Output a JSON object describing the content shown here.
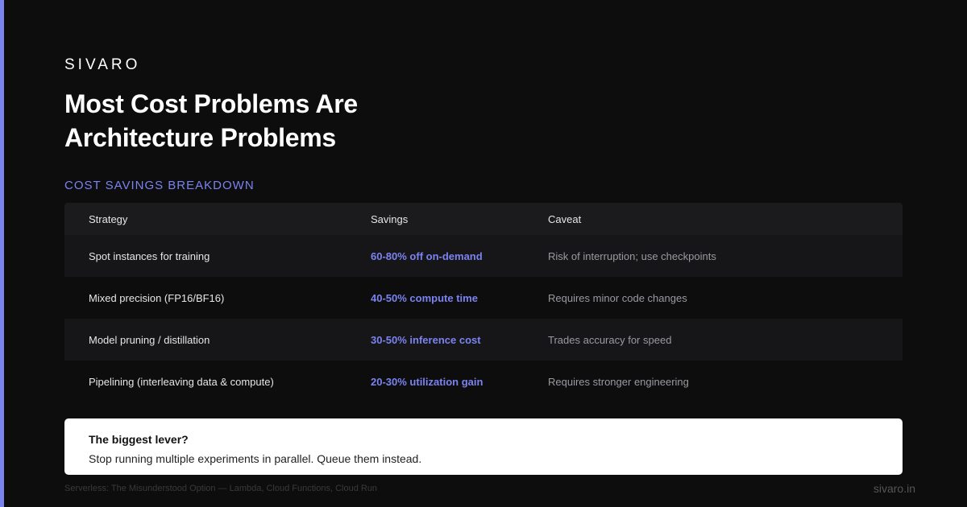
{
  "brand": "SIVARO",
  "title_lines": [
    "Most Cost Problems Are",
    "Architecture Problems"
  ],
  "section_label": "COST SAVINGS BREAKDOWN",
  "table": {
    "headers": [
      "Strategy",
      "Savings",
      "Caveat"
    ],
    "rows": [
      {
        "strategy": "Spot instances for training",
        "savings": "60-80% off on-demand",
        "caveat": "Risk of interruption; use checkpoints"
      },
      {
        "strategy": "Mixed precision (FP16/BF16)",
        "savings": "40-50% compute time",
        "caveat": "Requires minor code changes"
      },
      {
        "strategy": "Model pruning / distillation",
        "savings": "30-50% inference cost",
        "caveat": "Trades accuracy for speed"
      },
      {
        "strategy": "Pipelining (interleaving data & compute)",
        "savings": "20-30% utilization gain",
        "caveat": "Requires stronger engineering"
      }
    ]
  },
  "callout": {
    "title": "The biggest lever?",
    "body": "Stop running multiple experiments in parallel. Queue them instead."
  },
  "footer": {
    "left": "Serverless: The Misunderstood Option — Lambda, Cloud Functions, Cloud Run",
    "right": "sivaro.in"
  },
  "colors": {
    "accent": "#7b83f0",
    "background": "#0d0d0e"
  }
}
